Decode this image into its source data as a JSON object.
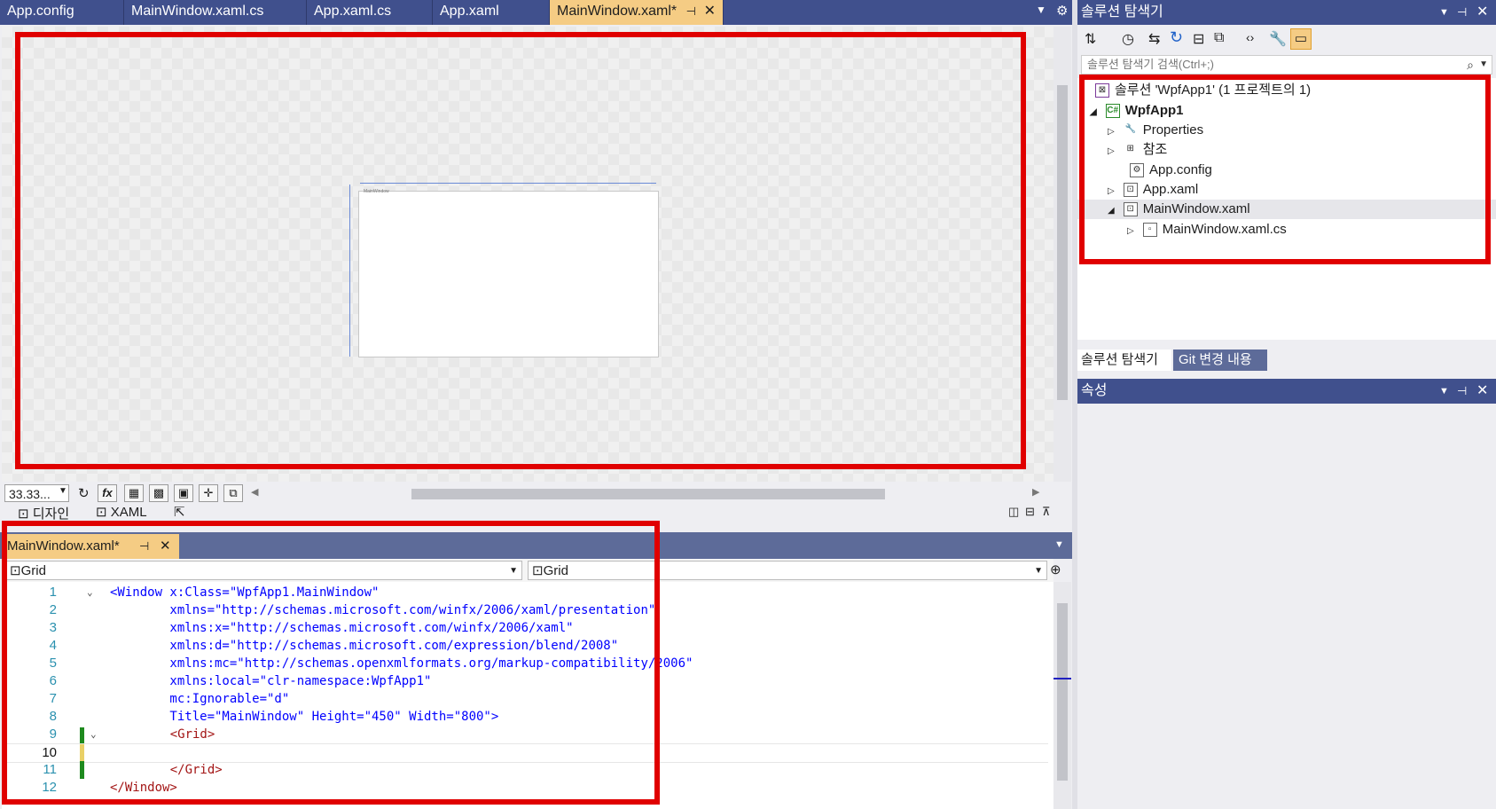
{
  "doc_tabs": [
    {
      "label": "App.config"
    },
    {
      "label": "MainWindow.xaml.cs"
    },
    {
      "label": "App.xaml.cs"
    },
    {
      "label": "App.xaml"
    },
    {
      "label": "MainWindow.xaml*"
    }
  ],
  "designer": {
    "window_title": "MainWindow",
    "zoom": "33.33...",
    "view_tabs": [
      "디자인",
      "XAML"
    ]
  },
  "xaml_pane": {
    "tab_label": "MainWindow.xaml*",
    "nav_left": "Grid",
    "nav_right": "Grid",
    "lines": [
      {
        "n": "1",
        "t": "<Window x:Class=\"WpfApp1.MainWindow\""
      },
      {
        "n": "2",
        "t": "        xmlns=\"http://schemas.microsoft.com/winfx/2006/xaml/presentation\""
      },
      {
        "n": "3",
        "t": "        xmlns:x=\"http://schemas.microsoft.com/winfx/2006/xaml\""
      },
      {
        "n": "4",
        "t": "        xmlns:d=\"http://schemas.microsoft.com/expression/blend/2008\""
      },
      {
        "n": "5",
        "t": "        xmlns:mc=\"http://schemas.openxmlformats.org/markup-compatibility/2006\""
      },
      {
        "n": "6",
        "t": "        xmlns:local=\"clr-namespace:WpfApp1\""
      },
      {
        "n": "7",
        "t": "        mc:Ignorable=\"d\""
      },
      {
        "n": "8",
        "t": "        Title=\"MainWindow\" Height=\"450\" Width=\"800\">"
      },
      {
        "n": "9",
        "t": "    <Grid>"
      },
      {
        "n": "10",
        "t": ""
      },
      {
        "n": "11",
        "t": "    </Grid>"
      },
      {
        "n": "12",
        "t": "</Window>"
      }
    ]
  },
  "solution_explorer": {
    "title": "솔루션 탐색기",
    "search_placeholder": "솔루션 탐색기 검색(Ctrl+;)",
    "items": [
      {
        "label": "솔루션 'WpfApp1' (1 프로젝트의 1)"
      },
      {
        "label": "WpfApp1"
      },
      {
        "label": "Properties"
      },
      {
        "label": "참조"
      },
      {
        "label": "App.config"
      },
      {
        "label": "App.xaml"
      },
      {
        "label": "MainWindow.xaml"
      },
      {
        "label": "MainWindow.xaml.cs"
      }
    ],
    "bottom_tabs": [
      "솔루션 탐색기",
      "Git 변경 내용"
    ]
  },
  "properties": {
    "title": "속성"
  },
  "colors": {
    "accent": "#40508d",
    "active_tab": "#f5cc84",
    "highlight": "#e00000"
  }
}
